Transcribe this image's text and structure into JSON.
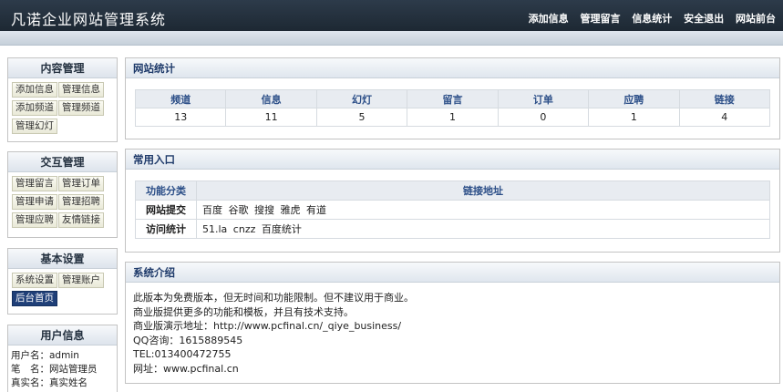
{
  "header": {
    "title": "凡诺企业网站管理系统",
    "nav": [
      "添加信息",
      "管理留言",
      "信息统计",
      "安全退出",
      "网站前台"
    ]
  },
  "sidebar": {
    "content": {
      "title": "内容管理",
      "buttons": [
        "添加信息",
        "管理信息",
        "添加频道",
        "管理频道",
        "管理幻灯"
      ]
    },
    "interaction": {
      "title": "交互管理",
      "buttons": [
        "管理留言",
        "管理订单",
        "管理申请",
        "管理招聘",
        "管理应聘",
        "友情链接"
      ]
    },
    "basic": {
      "title": "基本设置",
      "buttons": [
        "系统设置",
        "管理账户",
        "后台首页"
      ]
    },
    "user": {
      "title": "用户信息",
      "lines": [
        "用户名：admin",
        "笔　名：网站管理员",
        "真实名：真实姓名"
      ]
    }
  },
  "stats": {
    "title": "网站统计",
    "headers": [
      "频道",
      "信息",
      "幻灯",
      "留言",
      "订单",
      "应聘",
      "链接"
    ],
    "values": [
      "13",
      "11",
      "5",
      "1",
      "0",
      "1",
      "4"
    ]
  },
  "entries": {
    "title": "常用入口",
    "col_category": "功能分类",
    "col_links": "链接地址",
    "rows": [
      {
        "category": "网站提交",
        "links": [
          "百度",
          "谷歌",
          "搜搜",
          "雅虎",
          "有道"
        ]
      },
      {
        "category": "访问统计",
        "links": [
          "51.la",
          "cnzz",
          "百度统计"
        ]
      }
    ]
  },
  "intro": {
    "title": "系统介绍",
    "lines": [
      "此版本为免费版本，但无时间和功能限制。但不建议用于商业。",
      "商业版提供更多的功能和模板，并且有技术支持。",
      "商业版演示地址：http://www.pcfinal.cn/_qiye_business/",
      "QQ咨询：1615889545",
      "TEL:013400472755",
      "网址：www.pcfinal.cn"
    ]
  },
  "colors": {
    "topbar": "#1d2833",
    "accent": "#1f3f78",
    "section_title": "#1e3a6a"
  }
}
